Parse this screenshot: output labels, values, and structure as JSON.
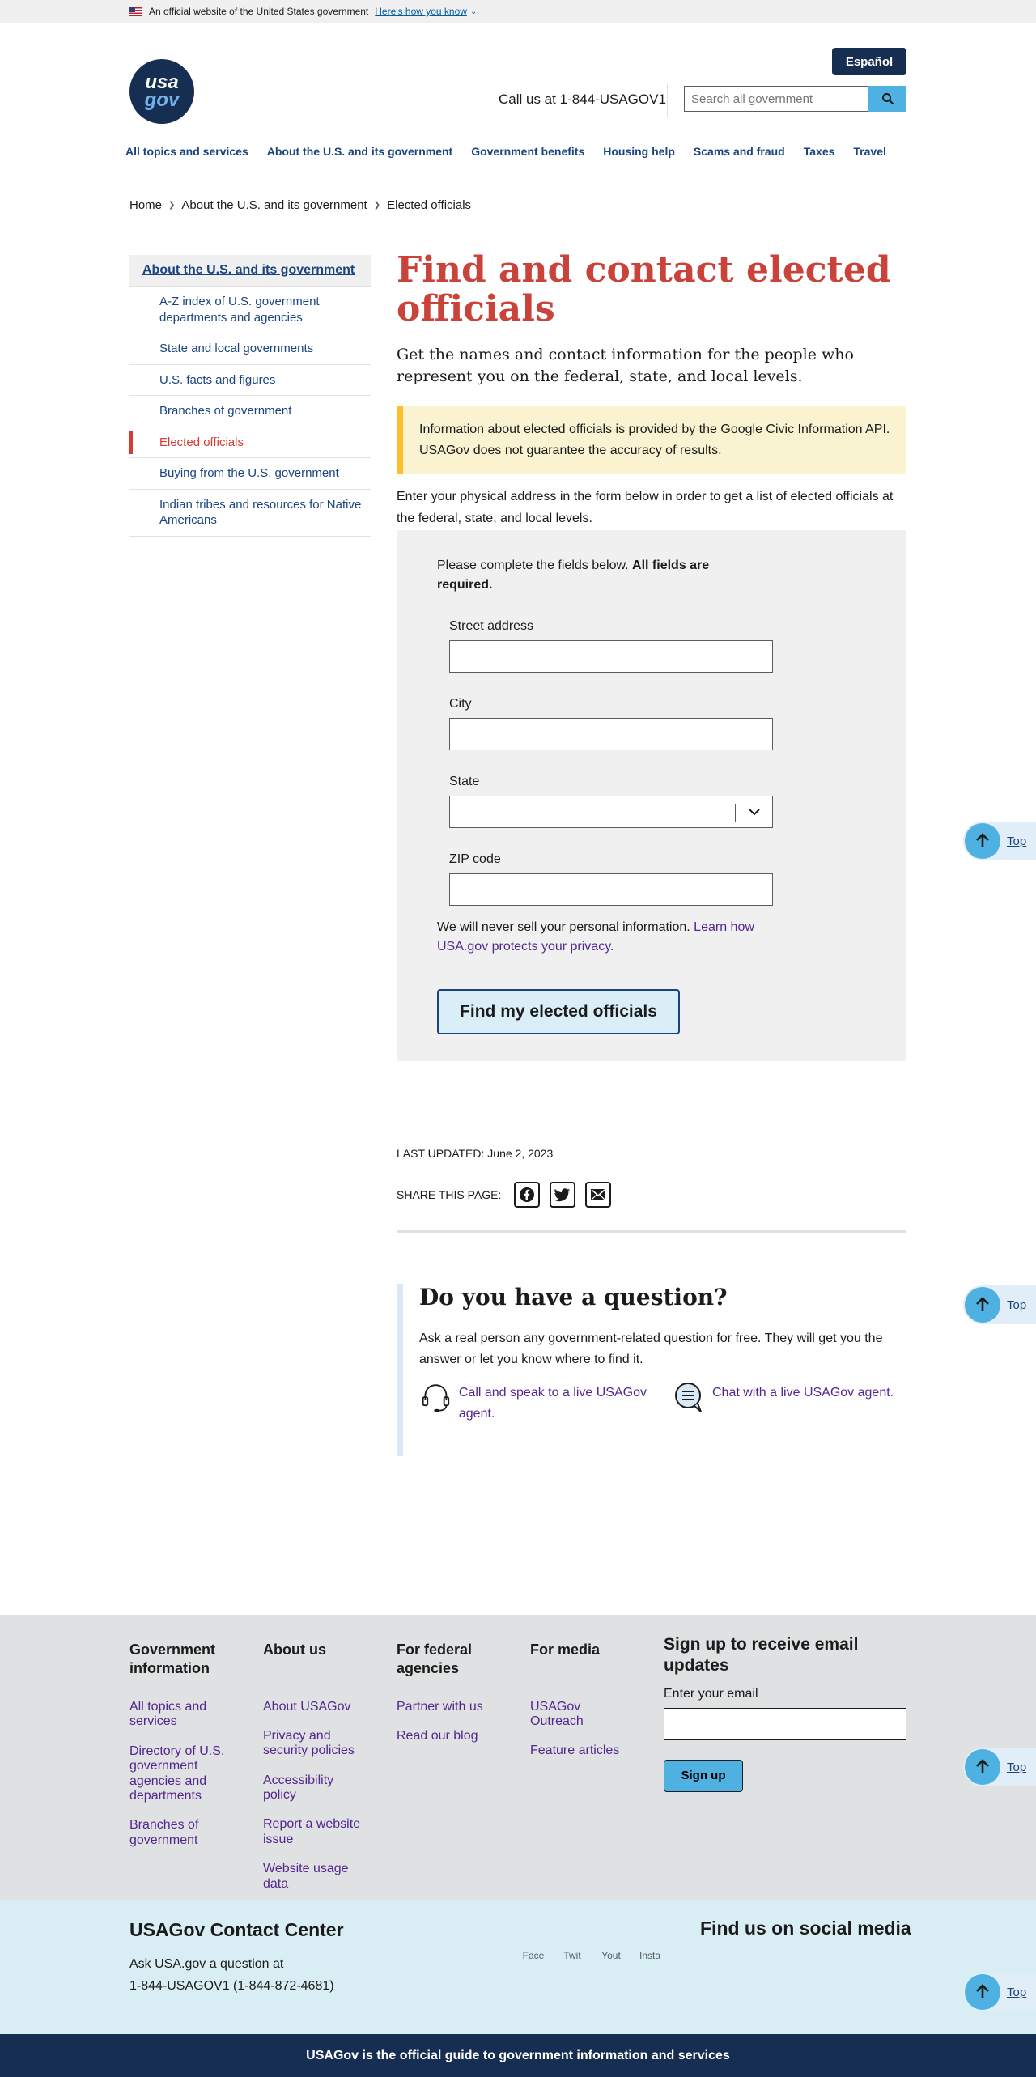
{
  "banner": {
    "text": "An official website of the United States government",
    "link": "Here's how you know"
  },
  "header": {
    "logo_line1": "usa",
    "logo_line2": "gov",
    "espanol": "Español",
    "call_us": "Call us at 1-844-USAGOV1",
    "search_placeholder": "Search all government"
  },
  "nav": {
    "items": [
      "All topics and services",
      "About the U.S. and its government",
      "Government benefits",
      "Housing help",
      "Scams and fraud",
      "Taxes",
      "Travel"
    ]
  },
  "breadcrumb": {
    "items": [
      "Home",
      "About the U.S. and its government"
    ],
    "current": "Elected officials"
  },
  "sidebar": {
    "top": "About the U.S. and its government",
    "items": [
      "A-Z index of U.S. government departments and agencies",
      "State and local governments",
      "U.S. facts and figures",
      "Branches of government",
      "Elected officials",
      "Buying from the U.S. government",
      "Indian tribes and resources for Native Americans"
    ],
    "active_index": 4
  },
  "main": {
    "title": "Find and contact elected officials",
    "lead": "Get the names and contact information for the people who represent you on the federal, state, and local levels.",
    "alert": "Information about elected officials is provided by the Google Civic Information API. USAGov does not guarantee the accuracy of results.",
    "intro": "Enter your physical address in the form below in order to get a list of elected officials at the federal, state, and local levels."
  },
  "form": {
    "note": "Please complete the fields below. ",
    "note_bold": "All fields are required.",
    "street_label": "Street address",
    "city_label": "City",
    "state_label": "State",
    "zip_label": "ZIP code",
    "privacy_text": "We will never sell your personal information. ",
    "privacy_link": "Learn how USA.gov protects your privacy.",
    "submit": "Find my elected officials"
  },
  "meta": {
    "last_updated": "LAST UPDATED: June 2, 2023",
    "share_label": "SHARE THIS PAGE:"
  },
  "question": {
    "title": "Do you have a question?",
    "text": "Ask a real person any government-related question for free. They will get you the answer or let you know where to find it.",
    "call_link": "Call and speak to a live USAGov agent.",
    "chat_link": "Chat with a live USAGov agent."
  },
  "top_label": "Top",
  "footer": {
    "col1": {
      "title": "Government information",
      "links": [
        "All topics and services",
        "Directory of U.S. government agencies and departments",
        "Branches of government"
      ]
    },
    "col2": {
      "title": "About us",
      "links": [
        "About USAGov",
        "Privacy and security policies",
        "Accessibility policy",
        "Report a website issue",
        "Website usage data"
      ]
    },
    "col3": {
      "title": "For federal agencies",
      "links": [
        "Partner with us",
        "Read our blog"
      ]
    },
    "col4": {
      "title": "For media",
      "links": [
        "USAGov Outreach",
        "Feature articles"
      ]
    },
    "signup": {
      "title": "Sign up to receive email updates",
      "label": "Enter your email",
      "button": "Sign up"
    }
  },
  "contact": {
    "title": "USAGov Contact Center",
    "line1": "Ask USA.gov a question at",
    "line2": "1-844-USAGOV1 (1-844-872-4681)",
    "social_title": "Find us on social media",
    "social": [
      "Face",
      "Twit",
      "Yout",
      "Insta"
    ]
  },
  "bottom": "USAGov is the official guide to government information and services"
}
